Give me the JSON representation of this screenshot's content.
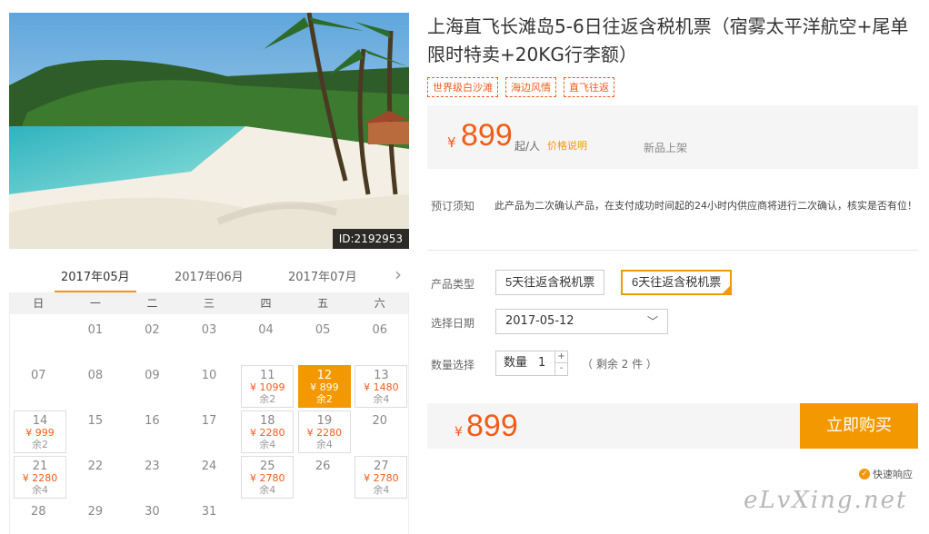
{
  "product": {
    "title": "上海直飞长滩岛5-6日往返含税机票（宿雾太平洋航空+尾单限时特卖+20KG行李额）",
    "id_label": "ID:2192953",
    "tags": [
      "世界级白沙滩",
      "海边风情",
      "直飞往返"
    ]
  },
  "price_box": {
    "currency": "¥",
    "price": "899",
    "per": "起/人",
    "explain_link": "价格说明",
    "status": "新品上架"
  },
  "notice": {
    "label": "预订须知",
    "text": "此产品为二次确认产品，在支付成功时间起的24小时内供应商将进行二次确认，核实是否有位！"
  },
  "form": {
    "type_label": "产品类型",
    "types": [
      "5天往返含税机票",
      "6天往返含税机票"
    ],
    "selected_type": "6天往返含税机票",
    "date_label": "选择日期",
    "date_value": "2017-05-12",
    "qty_section_label": "数量选择",
    "qty_label": "数量",
    "qty_value": "1",
    "qty_plus": "+",
    "qty_minus": "-",
    "remain": "（ 剩余 2 件 ）"
  },
  "buy": {
    "currency": "¥",
    "price": "899",
    "button": "立即购买",
    "quick_response": "快速响应"
  },
  "calendar": {
    "months": [
      "2017年05月",
      "2017年06月",
      "2017年07月"
    ],
    "active_month": "2017年05月",
    "weekdays": [
      "日",
      "一",
      "二",
      "三",
      "四",
      "五",
      "六"
    ],
    "cells": [
      {
        "day": ""
      },
      {
        "day": "01"
      },
      {
        "day": "02"
      },
      {
        "day": "03"
      },
      {
        "day": "04"
      },
      {
        "day": "05"
      },
      {
        "day": "06"
      },
      {
        "day": "07"
      },
      {
        "day": "08"
      },
      {
        "day": "09"
      },
      {
        "day": "10"
      },
      {
        "day": "11",
        "price": "¥ 1099",
        "remain": "余2"
      },
      {
        "day": "12",
        "price": "¥ 899",
        "remain": "余2",
        "selected": true
      },
      {
        "day": "13",
        "price": "¥ 1480",
        "remain": "余4"
      },
      {
        "day": "14",
        "price": "¥ 999",
        "remain": "余2"
      },
      {
        "day": "15"
      },
      {
        "day": "16"
      },
      {
        "day": "17"
      },
      {
        "day": "18",
        "price": "¥ 2280",
        "remain": "余4"
      },
      {
        "day": "19",
        "price": "¥ 2280",
        "remain": "余4"
      },
      {
        "day": "20"
      },
      {
        "day": "21",
        "price": "¥ 2280",
        "remain": "余4"
      },
      {
        "day": "22"
      },
      {
        "day": "23"
      },
      {
        "day": "24"
      },
      {
        "day": "25",
        "price": "¥ 2780",
        "remain": "余4"
      },
      {
        "day": "26"
      },
      {
        "day": "27",
        "price": "¥ 2780",
        "remain": "余4"
      },
      {
        "day": "28"
      },
      {
        "day": "29"
      },
      {
        "day": "30"
      },
      {
        "day": "31"
      }
    ]
  },
  "watermark": "eLvXing.net",
  "colors": {
    "accent": "#f39800",
    "price": "#f25c19"
  }
}
